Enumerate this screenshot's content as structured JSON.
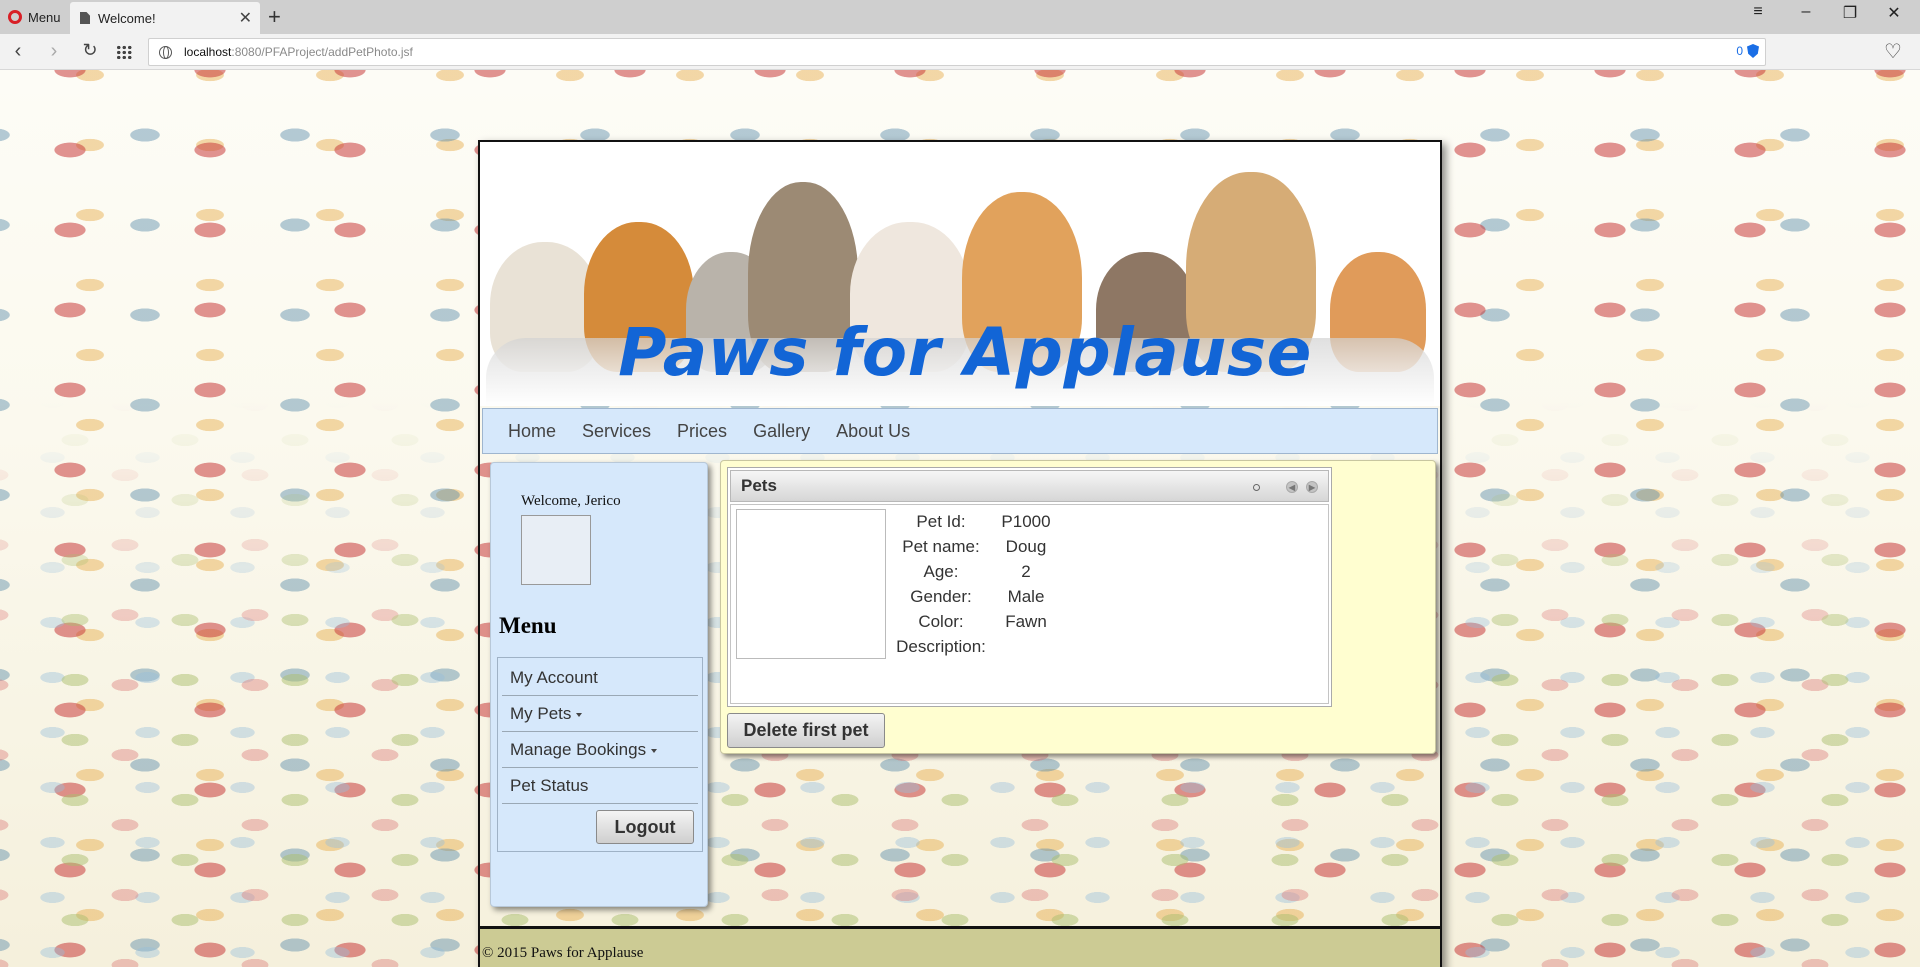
{
  "browser": {
    "menu_label": "Menu",
    "tab_title": "Welcome!",
    "url_host": "localhost",
    "url_path": ":8080/PFAProject/addPetPhoto.jsf",
    "adblock_count": "0"
  },
  "site": {
    "brand": "Paws for Applause",
    "nav": [
      "Home",
      "Services",
      "Prices",
      "Gallery",
      "About Us"
    ],
    "welcome": "Welcome, Jerico",
    "menu_heading": "Menu",
    "menu_items": [
      "My Account",
      "My Pets",
      "Manage Bookings",
      "Pet Status"
    ],
    "logout": "Logout",
    "footer": "© 2015 Paws for Applause"
  },
  "pets": {
    "panel_title": "Pets",
    "labels": {
      "id": "Pet Id:",
      "name": "Pet name:",
      "age": "Age:",
      "gender": "Gender:",
      "color": "Color:",
      "description": "Description:"
    },
    "record": {
      "id": "P1000",
      "name": "Doug",
      "age": "2",
      "gender": "Male",
      "color": "Fawn",
      "description": ""
    },
    "delete_button": "Delete first pet"
  },
  "colors": {
    "brand_blue": "#1265d6",
    "nav_bg": "#d6e8fb",
    "content_bg": "#fffed0",
    "footer_bg": "#cccb94"
  }
}
